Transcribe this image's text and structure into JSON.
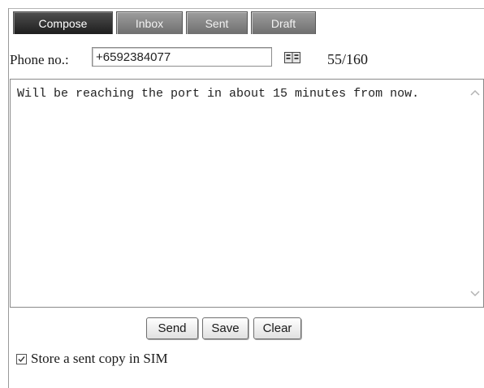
{
  "tabs": [
    {
      "label": "Compose",
      "active": true
    },
    {
      "label": "Inbox",
      "active": false
    },
    {
      "label": "Sent",
      "active": false
    },
    {
      "label": "Draft",
      "active": false
    }
  ],
  "phone": {
    "label": "Phone no.:",
    "value": "+6592384077",
    "contacts_icon": "address-book-icon"
  },
  "char_count": "55/160",
  "message": {
    "text": "Will be reaching the port in about 15 minutes from now."
  },
  "buttons": {
    "send": "Send",
    "save": "Save",
    "clear": "Clear"
  },
  "store_copy": {
    "label": "Store a sent copy in SIM",
    "checked": true
  },
  "colors": {
    "tab_active": "#2a2a2a",
    "tab_inactive": "#858585",
    "text": "#1a1a1a"
  }
}
